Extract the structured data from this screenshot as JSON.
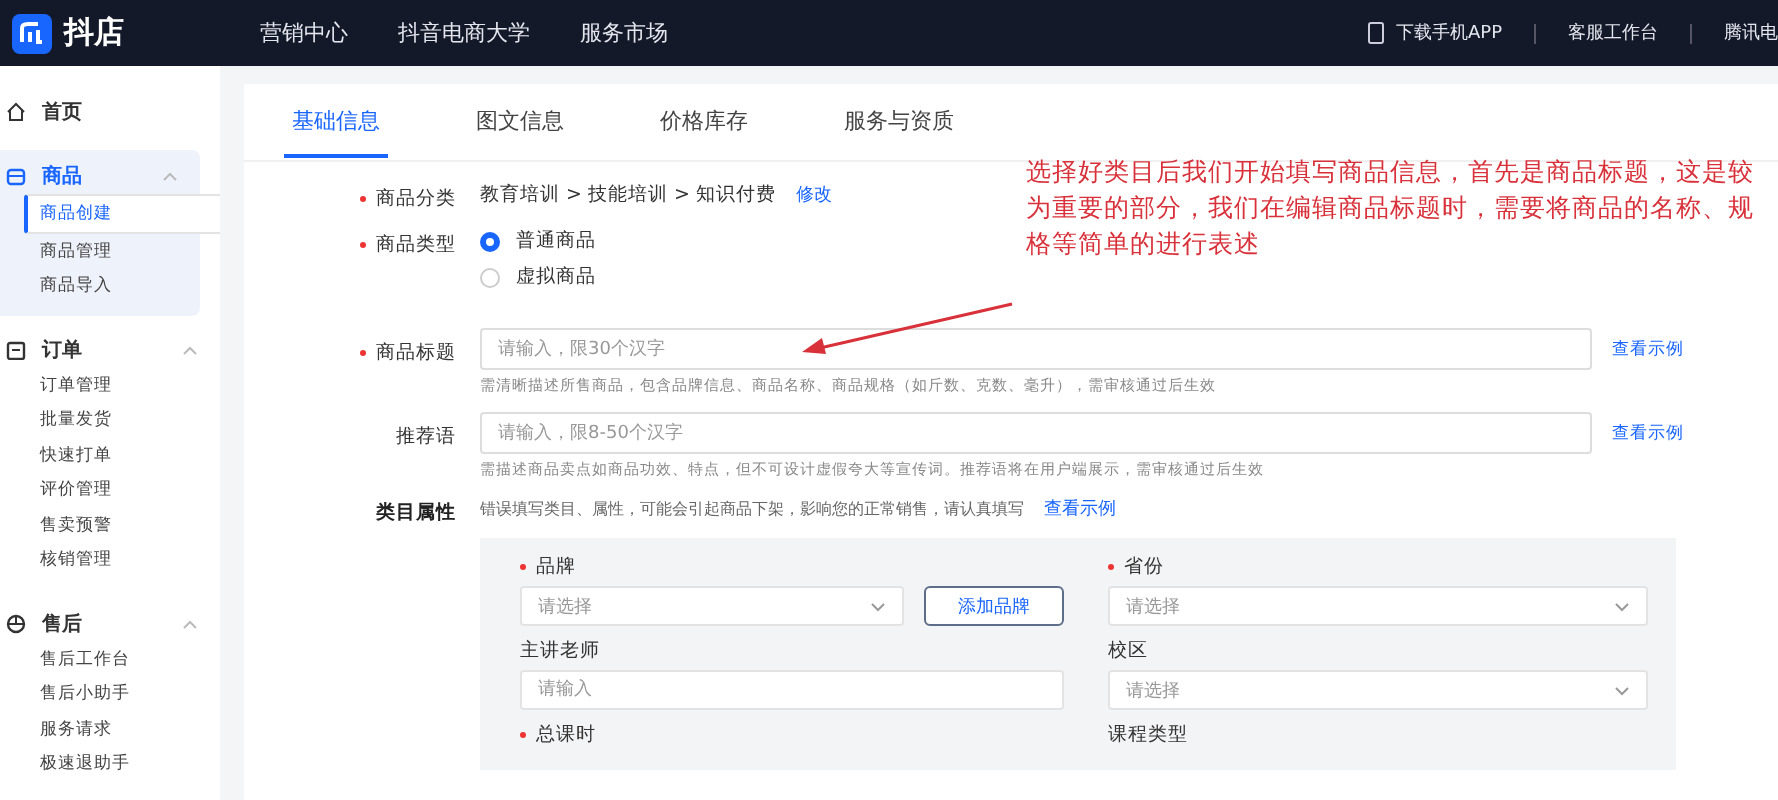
{
  "top_bar": {
    "logo_text": "抖店",
    "nav": [
      {
        "label": "营销中心"
      },
      {
        "label": "抖音电商大学"
      },
      {
        "label": "服务市场"
      }
    ],
    "right": [
      {
        "label": "下载手机APP",
        "kind": "phone"
      },
      {
        "label": "客服工作台",
        "kind": "plain"
      },
      {
        "label": "腾讯电",
        "kind": "plain"
      }
    ]
  },
  "sidebar": {
    "groups": [
      {
        "label": "首页"
      },
      {
        "label": "商品",
        "expanded": true,
        "children": [
          {
            "label": "商品创建",
            "selected": true
          },
          {
            "label": "商品管理",
            "selected": false
          },
          {
            "label": "商品导入",
            "selected": false
          }
        ]
      },
      {
        "label": "订单",
        "expanded": true,
        "children": [
          {
            "label": "订单管理",
            "selected": false
          },
          {
            "label": "批量发货",
            "selected": false
          },
          {
            "label": "快速打单",
            "selected": false
          },
          {
            "label": "评价管理",
            "selected": false
          },
          {
            "label": "售卖预警",
            "selected": false
          },
          {
            "label": "核销管理",
            "selected": false
          }
        ]
      },
      {
        "label": "售后",
        "expanded": true,
        "children": [
          {
            "label": "售后工作台",
            "selected": false
          },
          {
            "label": "售后小助手",
            "selected": false
          },
          {
            "label": "服务请求",
            "selected": false
          },
          {
            "label": "极速退助手",
            "selected": false
          }
        ]
      }
    ]
  },
  "tabs": [
    {
      "label": "基础信息",
      "selected": true
    },
    {
      "label": "图文信息",
      "selected": false
    },
    {
      "label": "价格库存",
      "selected": false
    },
    {
      "label": "服务与资质",
      "selected": false
    }
  ],
  "form": [
    {
      "kind": "category",
      "label": "商品分类",
      "required": true,
      "value": "教育培训 > 技能培训 > 知识付费",
      "link": "修改"
    },
    {
      "kind": "radio",
      "label": "商品类型",
      "required": true,
      "options": [
        {
          "label": "普通商品",
          "selected": true
        },
        {
          "label": "虚拟商品",
          "selected": false
        }
      ]
    },
    {
      "kind": "input",
      "label": "商品标题",
      "required": true,
      "placeholder": "请输入，限30个汉字",
      "link": "查看示例",
      "help": "需清晰描述所售商品，包含品牌信息、商品名称、商品规格（如斤数、克数、毫升），需审核通过后生效"
    },
    {
      "kind": "input",
      "label": "推荐语",
      "required": false,
      "placeholder": "请输入，限8-50个汉字",
      "link": "查看示例",
      "help": "需描述商品卖点如商品功效、特点，但不可设计虚假夸大等宣传词。推荐语将在用户端展示，需审核通过后生效"
    },
    {
      "kind": "attributes",
      "label": "类目属性",
      "required": false,
      "note": "错误填写类目、属性，可能会引起商品下架，影响您的正常销售，请认真填写",
      "link": "查看示例"
    }
  ],
  "attributes": [
    {
      "kind": "select",
      "label": "品牌",
      "required": true,
      "placeholder": "请选择",
      "button": "添加品牌"
    },
    {
      "kind": "select",
      "label": "省份",
      "required": true,
      "placeholder": "请选择"
    },
    {
      "kind": "input",
      "label": "主讲老师",
      "required": false,
      "placeholder": "请输入"
    },
    {
      "kind": "select",
      "label": "校区",
      "required": false,
      "placeholder": "请选择"
    },
    {
      "kind": "label",
      "label": "总课时",
      "required": true
    },
    {
      "kind": "label",
      "label": "课程类型",
      "required": false
    }
  ],
  "annotation": {
    "text": "选择好类目后我们开始填写商品信息，首先是商品标题，这是较为重要的部分，我们在编辑商品标题时，需要将商品的名称、规格等简单的进行表述"
  }
}
